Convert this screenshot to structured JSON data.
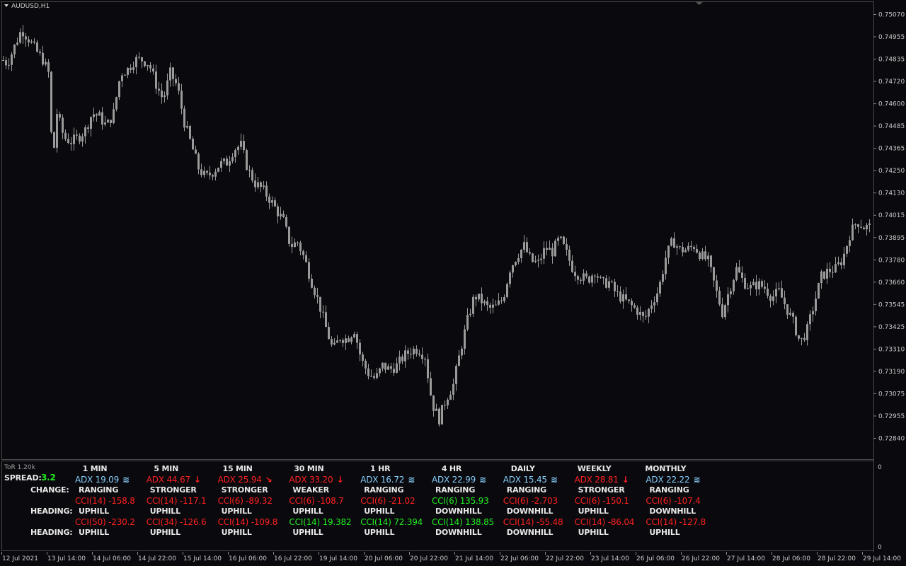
{
  "symbol": "AUDUSD,H1",
  "indicator_name": "ToR 1.20k",
  "colors": {
    "background": "#0a0a0e",
    "candle": "#9a9a9a",
    "grid": "#4a4a4a",
    "text": "#e8e8e8",
    "ranging": "#87cefa",
    "bearish": "#ff2020",
    "bullish": "#22ee22"
  },
  "price_axis": [
    "0.75070",
    "0.74955",
    "0.74835",
    "0.74720",
    "0.74600",
    "0.74485",
    "0.74365",
    "0.74250",
    "0.74130",
    "0.74015",
    "0.73895",
    "0.73780",
    "0.73660",
    "0.73545",
    "0.73425",
    "0.73310",
    "0.73190",
    "0.73075",
    "0.72955",
    "0.72840"
  ],
  "indicator_axis": [
    "0",
    "0"
  ],
  "time_axis": [
    "12 Jul 2021",
    "13 Jul 14:00",
    "14 Jul 06:00",
    "14 Jul 22:00",
    "15 Jul 14:00",
    "16 Jul 06:00",
    "16 Jul 22:00",
    "19 Jul 14:00",
    "20 Jul 06:00",
    "20 Jul 22:00",
    "21 Jul 14:00",
    "22 Jul 06:00",
    "22 Jul 22:00",
    "23 Jul 14:00",
    "26 Jul 06:00",
    "26 Jul 22:00",
    "27 Jul 14:00",
    "28 Jul 06:00",
    "28 Jul 22:00",
    "29 Jul 14:00"
  ],
  "panel": {
    "spread_label": "SPREAD:",
    "spread_value": "3.2",
    "change_label": "CHANGE:",
    "heading_label_1": "HEADING:",
    "heading_label_2": "HEADING:",
    "columns": [
      {
        "tf": "1 MIN",
        "adx": "ADX 19.09",
        "adx_color": "blue",
        "adx_icon": "wave-icon",
        "state": "RANGING",
        "cci1": "CCI(14) -158.8",
        "cci1_color": "red",
        "head1": "UPHILL",
        "cci2": "CCI(50) -230.2",
        "cci2_color": "red",
        "head2": "UPHILL"
      },
      {
        "tf": "5 MIN",
        "adx": "ADX 44.67",
        "adx_color": "red",
        "adx_icon": "arrow-down-icon",
        "state": "STRONGER",
        "cci1": "CCI(14) -117.1",
        "cci1_color": "red",
        "head1": "UPHILL",
        "cci2": "CCI(34) -126.6",
        "cci2_color": "red",
        "head2": "UPHILL"
      },
      {
        "tf": "15 MIN",
        "adx": "ADX 25.94",
        "adx_color": "red",
        "adx_icon": "arrow-down-right-icon",
        "state": "STRONGER",
        "cci1": "CCI(6) -89.32",
        "cci1_color": "red",
        "head1": "UPHILL",
        "cci2": "CCI(14) -109.8",
        "cci2_color": "red",
        "head2": "UPHILL"
      },
      {
        "tf": "30 MIN",
        "adx": "ADX 33.20",
        "adx_color": "red",
        "adx_icon": "arrow-down-icon",
        "state": "WEAKER",
        "cci1": "CCI(6) -108.7",
        "cci1_color": "red",
        "head1": "UPHILL",
        "cci2": "CCI(14) 19.382",
        "cci2_color": "green",
        "head2": "UPHILL"
      },
      {
        "tf": "1 HR",
        "adx": "ADX 16.72",
        "adx_color": "blue",
        "adx_icon": "wave-icon",
        "state": "RANGING",
        "cci1": "CCI(6) -21.02",
        "cci1_color": "red",
        "head1": "UPHILL",
        "cci2": "CCI(14) 72.394",
        "cci2_color": "green",
        "head2": "UPHILL"
      },
      {
        "tf": "4 HR",
        "adx": "ADX 22.99",
        "adx_color": "blue",
        "adx_icon": "wave-icon",
        "state": "RANGING",
        "cci1": "CCI(6) 135.93",
        "cci1_color": "green",
        "head1": "DOWNHILL",
        "cci2": "CCI(14) 138.85",
        "cci2_color": "green",
        "head2": "DOWNHILL"
      },
      {
        "tf": "DAILY",
        "adx": "ADX 15.45",
        "adx_color": "blue",
        "adx_icon": "wave-icon",
        "state": "RANGING",
        "cci1": "CCI(6) -2.703",
        "cci1_color": "red",
        "head1": "DOWNHILL",
        "cci2": "CCI(14) -55.48",
        "cci2_color": "red",
        "head2": "DOWNHILL"
      },
      {
        "tf": "WEEKLY",
        "adx": "ADX 28.81",
        "adx_color": "red",
        "adx_icon": "arrow-down-icon",
        "state": "STRONGER",
        "cci1": "CCI(6) -150.1",
        "cci1_color": "red",
        "head1": "UPHILL",
        "cci2": "CCI(14) -86.04",
        "cci2_color": "red",
        "head2": "UPHILL"
      },
      {
        "tf": "MONTHLY",
        "adx": "ADX 22.22",
        "adx_color": "blue",
        "adx_icon": "wave-icon",
        "state": "RANGING",
        "cci1": "CCI(6) -107.4",
        "cci1_color": "red",
        "head1": "DOWNHILL",
        "cci2": "CCI(14) -127.8",
        "cci2_color": "red",
        "head2": "UPHILL"
      }
    ]
  },
  "chart_data": {
    "type": "candlestick",
    "symbol": "AUDUSD",
    "timeframe": "H1",
    "ylim": [
      0.7284,
      0.7507
    ],
    "close_path": [
      [
        0,
        0.7484
      ],
      [
        10,
        0.7481
      ],
      [
        20,
        0.749
      ],
      [
        30,
        0.7499
      ],
      [
        40,
        0.7494
      ],
      [
        50,
        0.7488
      ],
      [
        60,
        0.7483
      ],
      [
        68,
        0.7476
      ],
      [
        74,
        0.7428
      ],
      [
        80,
        0.7455
      ],
      [
        90,
        0.7442
      ],
      [
        100,
        0.744
      ],
      [
        110,
        0.7442
      ],
      [
        120,
        0.7446
      ],
      [
        130,
        0.7455
      ],
      [
        140,
        0.7453
      ],
      [
        150,
        0.7448
      ],
      [
        160,
        0.7455
      ],
      [
        170,
        0.7476
      ],
      [
        180,
        0.7478
      ],
      [
        190,
        0.7483
      ],
      [
        200,
        0.7483
      ],
      [
        210,
        0.7481
      ],
      [
        220,
        0.747
      ],
      [
        230,
        0.7462
      ],
      [
        240,
        0.7476
      ],
      [
        250,
        0.7469
      ],
      [
        260,
        0.745
      ],
      [
        270,
        0.7438
      ],
      [
        280,
        0.7426
      ],
      [
        290,
        0.7421
      ],
      [
        300,
        0.7424
      ],
      [
        310,
        0.7428
      ],
      [
        320,
        0.7429
      ],
      [
        330,
        0.7436
      ],
      [
        340,
        0.7438
      ],
      [
        350,
        0.7425
      ],
      [
        360,
        0.7418
      ],
      [
        370,
        0.7415
      ],
      [
        380,
        0.741
      ],
      [
        390,
        0.7404
      ],
      [
        400,
        0.7398
      ],
      [
        410,
        0.7385
      ],
      [
        420,
        0.7387
      ],
      [
        430,
        0.7378
      ],
      [
        440,
        0.7366
      ],
      [
        450,
        0.7355
      ],
      [
        460,
        0.7342
      ],
      [
        470,
        0.733
      ],
      [
        480,
        0.7337
      ],
      [
        490,
        0.7336
      ],
      [
        500,
        0.7341
      ],
      [
        510,
        0.7325
      ],
      [
        520,
        0.7318
      ],
      [
        530,
        0.7315
      ],
      [
        540,
        0.7322
      ],
      [
        550,
        0.732
      ],
      [
        560,
        0.7322
      ],
      [
        570,
        0.7327
      ],
      [
        580,
        0.733
      ],
      [
        590,
        0.7331
      ],
      [
        600,
        0.7327
      ],
      [
        610,
        0.7302
      ],
      [
        620,
        0.7294
      ],
      [
        630,
        0.7305
      ],
      [
        640,
        0.7312
      ],
      [
        650,
        0.733
      ],
      [
        660,
        0.7346
      ],
      [
        670,
        0.7359
      ],
      [
        680,
        0.7356
      ],
      [
        690,
        0.7352
      ],
      [
        700,
        0.7353
      ],
      [
        710,
        0.7357
      ],
      [
        720,
        0.7373
      ],
      [
        730,
        0.738
      ],
      [
        740,
        0.7385
      ],
      [
        750,
        0.7377
      ],
      [
        760,
        0.7376
      ],
      [
        770,
        0.7384
      ],
      [
        780,
        0.7382
      ],
      [
        790,
        0.7389
      ],
      [
        800,
        0.7381
      ],
      [
        810,
        0.7372
      ],
      [
        820,
        0.7369
      ],
      [
        830,
        0.7367
      ],
      [
        840,
        0.7372
      ],
      [
        850,
        0.7365
      ],
      [
        860,
        0.7366
      ],
      [
        870,
        0.736
      ],
      [
        880,
        0.7357
      ],
      [
        890,
        0.7354
      ],
      [
        900,
        0.7351
      ],
      [
        910,
        0.7346
      ],
      [
        920,
        0.7355
      ],
      [
        930,
        0.7362
      ],
      [
        940,
        0.7379
      ],
      [
        950,
        0.7388
      ],
      [
        960,
        0.7383
      ],
      [
        970,
        0.7383
      ],
      [
        980,
        0.7385
      ],
      [
        990,
        0.738
      ],
      [
        1000,
        0.7377
      ],
      [
        1010,
        0.7363
      ],
      [
        1020,
        0.735
      ],
      [
        1030,
        0.7362
      ],
      [
        1040,
        0.7373
      ],
      [
        1050,
        0.7366
      ],
      [
        1060,
        0.7363
      ],
      [
        1070,
        0.7365
      ],
      [
        1080,
        0.7363
      ],
      [
        1090,
        0.7358
      ],
      [
        1100,
        0.7361
      ],
      [
        1110,
        0.7353
      ],
      [
        1120,
        0.7345
      ],
      [
        1130,
        0.7334
      ],
      [
        1140,
        0.7341
      ],
      [
        1150,
        0.7355
      ],
      [
        1160,
        0.7369
      ],
      [
        1170,
        0.7372
      ],
      [
        1180,
        0.7373
      ],
      [
        1190,
        0.7378
      ],
      [
        1200,
        0.7391
      ],
      [
        1210,
        0.7398
      ],
      [
        1220,
        0.7395
      ]
    ]
  }
}
